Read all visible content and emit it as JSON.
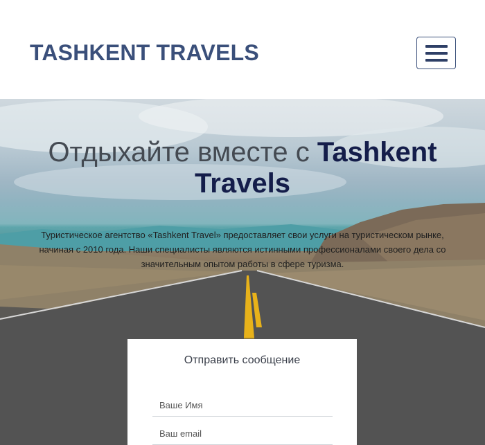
{
  "header": {
    "brand": "TASHKENT TRAVELS",
    "menu_icon": "hamburger-menu-icon"
  },
  "hero": {
    "title_light": "Отдыхайте вместе с ",
    "title_bold_1": "Tashkent",
    "title_bold_2": "Travels",
    "description": "Туристическое агентство «Tashkent Travel» предоставляет свои услуги на туристическом рынке, начиная с 2010 года. Наши специалисты являются истинными профессионалами своего дела со значительным опытом работы в сфере туризма."
  },
  "contact_form": {
    "title": "Отправить сообщение",
    "name_placeholder": "Ваше Имя",
    "email_placeholder": "Ваш email"
  },
  "colors": {
    "brand": "#3a4f7a",
    "title_accent": "#141d4a",
    "road_line": "#e8b21a"
  }
}
